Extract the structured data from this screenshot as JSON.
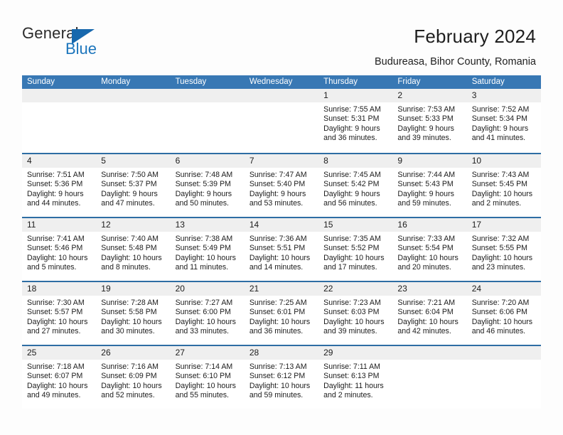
{
  "brand": {
    "name_top": "General",
    "name_bottom": "Blue",
    "accent_color": "#1c75bc",
    "triangle_color": "#1768ad"
  },
  "header": {
    "title": "February 2024",
    "subtitle": "Budureasa, Bihor County, Romania"
  },
  "calendar": {
    "header_bg": "#3878b4",
    "row_border_color": "#2e6da4",
    "day_band_bg": "#efefef",
    "weekdays": [
      "Sunday",
      "Monday",
      "Tuesday",
      "Wednesday",
      "Thursday",
      "Friday",
      "Saturday"
    ],
    "weeks": [
      [
        {
          "day": "",
          "sunrise": "",
          "sunset": "",
          "daylight_line1": "",
          "daylight_line2": ""
        },
        {
          "day": "",
          "sunrise": "",
          "sunset": "",
          "daylight_line1": "",
          "daylight_line2": ""
        },
        {
          "day": "",
          "sunrise": "",
          "sunset": "",
          "daylight_line1": "",
          "daylight_line2": ""
        },
        {
          "day": "",
          "sunrise": "",
          "sunset": "",
          "daylight_line1": "",
          "daylight_line2": ""
        },
        {
          "day": "1",
          "sunrise": "Sunrise: 7:55 AM",
          "sunset": "Sunset: 5:31 PM",
          "daylight_line1": "Daylight: 9 hours",
          "daylight_line2": "and 36 minutes."
        },
        {
          "day": "2",
          "sunrise": "Sunrise: 7:53 AM",
          "sunset": "Sunset: 5:33 PM",
          "daylight_line1": "Daylight: 9 hours",
          "daylight_line2": "and 39 minutes."
        },
        {
          "day": "3",
          "sunrise": "Sunrise: 7:52 AM",
          "sunset": "Sunset: 5:34 PM",
          "daylight_line1": "Daylight: 9 hours",
          "daylight_line2": "and 41 minutes."
        }
      ],
      [
        {
          "day": "4",
          "sunrise": "Sunrise: 7:51 AM",
          "sunset": "Sunset: 5:36 PM",
          "daylight_line1": "Daylight: 9 hours",
          "daylight_line2": "and 44 minutes."
        },
        {
          "day": "5",
          "sunrise": "Sunrise: 7:50 AM",
          "sunset": "Sunset: 5:37 PM",
          "daylight_line1": "Daylight: 9 hours",
          "daylight_line2": "and 47 minutes."
        },
        {
          "day": "6",
          "sunrise": "Sunrise: 7:48 AM",
          "sunset": "Sunset: 5:39 PM",
          "daylight_line1": "Daylight: 9 hours",
          "daylight_line2": "and 50 minutes."
        },
        {
          "day": "7",
          "sunrise": "Sunrise: 7:47 AM",
          "sunset": "Sunset: 5:40 PM",
          "daylight_line1": "Daylight: 9 hours",
          "daylight_line2": "and 53 minutes."
        },
        {
          "day": "8",
          "sunrise": "Sunrise: 7:45 AM",
          "sunset": "Sunset: 5:42 PM",
          "daylight_line1": "Daylight: 9 hours",
          "daylight_line2": "and 56 minutes."
        },
        {
          "day": "9",
          "sunrise": "Sunrise: 7:44 AM",
          "sunset": "Sunset: 5:43 PM",
          "daylight_line1": "Daylight: 9 hours",
          "daylight_line2": "and 59 minutes."
        },
        {
          "day": "10",
          "sunrise": "Sunrise: 7:43 AM",
          "sunset": "Sunset: 5:45 PM",
          "daylight_line1": "Daylight: 10 hours",
          "daylight_line2": "and 2 minutes."
        }
      ],
      [
        {
          "day": "11",
          "sunrise": "Sunrise: 7:41 AM",
          "sunset": "Sunset: 5:46 PM",
          "daylight_line1": "Daylight: 10 hours",
          "daylight_line2": "and 5 minutes."
        },
        {
          "day": "12",
          "sunrise": "Sunrise: 7:40 AM",
          "sunset": "Sunset: 5:48 PM",
          "daylight_line1": "Daylight: 10 hours",
          "daylight_line2": "and 8 minutes."
        },
        {
          "day": "13",
          "sunrise": "Sunrise: 7:38 AM",
          "sunset": "Sunset: 5:49 PM",
          "daylight_line1": "Daylight: 10 hours",
          "daylight_line2": "and 11 minutes."
        },
        {
          "day": "14",
          "sunrise": "Sunrise: 7:36 AM",
          "sunset": "Sunset: 5:51 PM",
          "daylight_line1": "Daylight: 10 hours",
          "daylight_line2": "and 14 minutes."
        },
        {
          "day": "15",
          "sunrise": "Sunrise: 7:35 AM",
          "sunset": "Sunset: 5:52 PM",
          "daylight_line1": "Daylight: 10 hours",
          "daylight_line2": "and 17 minutes."
        },
        {
          "day": "16",
          "sunrise": "Sunrise: 7:33 AM",
          "sunset": "Sunset: 5:54 PM",
          "daylight_line1": "Daylight: 10 hours",
          "daylight_line2": "and 20 minutes."
        },
        {
          "day": "17",
          "sunrise": "Sunrise: 7:32 AM",
          "sunset": "Sunset: 5:55 PM",
          "daylight_line1": "Daylight: 10 hours",
          "daylight_line2": "and 23 minutes."
        }
      ],
      [
        {
          "day": "18",
          "sunrise": "Sunrise: 7:30 AM",
          "sunset": "Sunset: 5:57 PM",
          "daylight_line1": "Daylight: 10 hours",
          "daylight_line2": "and 27 minutes."
        },
        {
          "day": "19",
          "sunrise": "Sunrise: 7:28 AM",
          "sunset": "Sunset: 5:58 PM",
          "daylight_line1": "Daylight: 10 hours",
          "daylight_line2": "and 30 minutes."
        },
        {
          "day": "20",
          "sunrise": "Sunrise: 7:27 AM",
          "sunset": "Sunset: 6:00 PM",
          "daylight_line1": "Daylight: 10 hours",
          "daylight_line2": "and 33 minutes."
        },
        {
          "day": "21",
          "sunrise": "Sunrise: 7:25 AM",
          "sunset": "Sunset: 6:01 PM",
          "daylight_line1": "Daylight: 10 hours",
          "daylight_line2": "and 36 minutes."
        },
        {
          "day": "22",
          "sunrise": "Sunrise: 7:23 AM",
          "sunset": "Sunset: 6:03 PM",
          "daylight_line1": "Daylight: 10 hours",
          "daylight_line2": "and 39 minutes."
        },
        {
          "day": "23",
          "sunrise": "Sunrise: 7:21 AM",
          "sunset": "Sunset: 6:04 PM",
          "daylight_line1": "Daylight: 10 hours",
          "daylight_line2": "and 42 minutes."
        },
        {
          "day": "24",
          "sunrise": "Sunrise: 7:20 AM",
          "sunset": "Sunset: 6:06 PM",
          "daylight_line1": "Daylight: 10 hours",
          "daylight_line2": "and 46 minutes."
        }
      ],
      [
        {
          "day": "25",
          "sunrise": "Sunrise: 7:18 AM",
          "sunset": "Sunset: 6:07 PM",
          "daylight_line1": "Daylight: 10 hours",
          "daylight_line2": "and 49 minutes."
        },
        {
          "day": "26",
          "sunrise": "Sunrise: 7:16 AM",
          "sunset": "Sunset: 6:09 PM",
          "daylight_line1": "Daylight: 10 hours",
          "daylight_line2": "and 52 minutes."
        },
        {
          "day": "27",
          "sunrise": "Sunrise: 7:14 AM",
          "sunset": "Sunset: 6:10 PM",
          "daylight_line1": "Daylight: 10 hours",
          "daylight_line2": "and 55 minutes."
        },
        {
          "day": "28",
          "sunrise": "Sunrise: 7:13 AM",
          "sunset": "Sunset: 6:12 PM",
          "daylight_line1": "Daylight: 10 hours",
          "daylight_line2": "and 59 minutes."
        },
        {
          "day": "29",
          "sunrise": "Sunrise: 7:11 AM",
          "sunset": "Sunset: 6:13 PM",
          "daylight_line1": "Daylight: 11 hours",
          "daylight_line2": "and 2 minutes."
        },
        {
          "day": "",
          "sunrise": "",
          "sunset": "",
          "daylight_line1": "",
          "daylight_line2": ""
        },
        {
          "day": "",
          "sunrise": "",
          "sunset": "",
          "daylight_line1": "",
          "daylight_line2": ""
        }
      ]
    ]
  }
}
